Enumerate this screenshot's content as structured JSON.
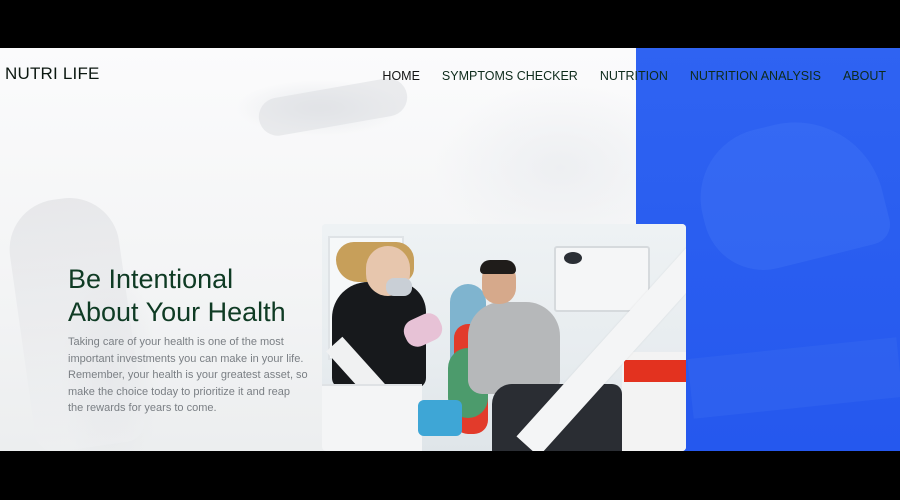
{
  "brand": {
    "logo": "NUTRI LIFE"
  },
  "nav": {
    "items": [
      {
        "label": "HOME"
      },
      {
        "label": "SYMPTOMS CHECKER"
      },
      {
        "label": "NUTRITION"
      },
      {
        "label": "NUTRITION ANALYSIS"
      },
      {
        "label": "ABOUT"
      }
    ]
  },
  "hero": {
    "title_line1": "Be Intentional",
    "title_line2": "About Your Health",
    "text": "Taking care of your health is one of the most important investments you can make in your life. Remember, your health is your greatest asset, so make the choice today to prioritize it and reap the rewards for years to come."
  },
  "colors": {
    "accent_blue": "#2a5ef0",
    "title_green": "#0f3b24",
    "nav_text": "#0d2b1b",
    "body_text": "#7a7f84"
  },
  "icons": []
}
